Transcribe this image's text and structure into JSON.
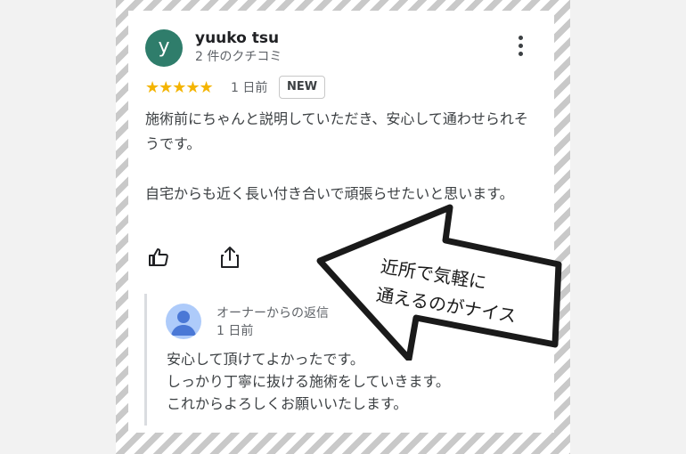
{
  "review": {
    "avatar_letter": "y",
    "username": "yuuko tsu",
    "review_count": "2 件のクチコミ",
    "rating": 5,
    "rating_stars": "★★★★★",
    "date": "1 日前",
    "badge": "NEW",
    "paragraphs": [
      "施術前にちゃんと説明していただき、安心して通わせられそうです。",
      "自宅からも近く長い付き合いで頑張らせたいと思います。"
    ],
    "actions": {
      "like_icon": "thumbs-up-icon",
      "share_icon": "share-icon"
    }
  },
  "owner_reply": {
    "title": "オーナーからの返信",
    "date": "1 日前",
    "lines": [
      "安心して頂けてよかったです。",
      "しっかり丁寧に抜ける施術をしていきます。",
      "これからよろしくお願いいたします。"
    ]
  },
  "annotation": {
    "line1": "近所で気軽に",
    "line2": "通えるのがナイス"
  },
  "colors": {
    "avatar": "#2f7d6b",
    "star": "#f4b400",
    "text": "#3c4043",
    "muted": "#5f6368",
    "owner_avatar": "#aecbfa",
    "stripe": "#c9c9c9"
  }
}
